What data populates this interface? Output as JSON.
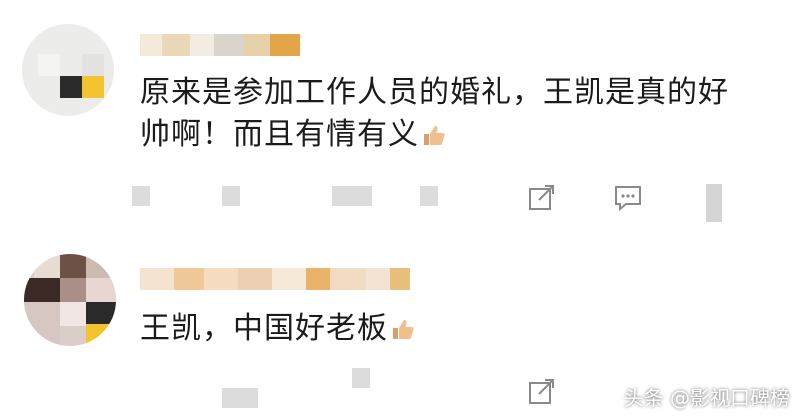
{
  "comments": [
    {
      "lines": [
        "原来是参加工作人员的婚礼，王凯是真的好",
        "帅啊！而且有情有义"
      ],
      "has_thumb": true
    },
    {
      "lines": [
        "王凯，中国好老板"
      ],
      "has_thumb": true
    }
  ],
  "actions": {
    "share_icon": "share-icon",
    "comment_icon": "comment-icon"
  },
  "watermark": "头条 @影视口碑榜",
  "colors": {
    "text": "#1b1b1b",
    "icon": "#8a8a8a",
    "thumb": "#e9b98a"
  }
}
